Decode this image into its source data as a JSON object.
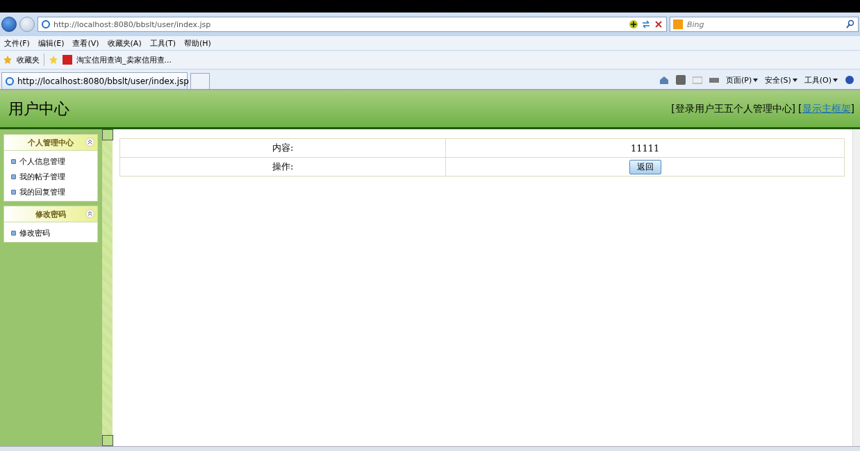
{
  "browser": {
    "address": "http://localhost:8080/bbslt/user/index.jsp",
    "search_placeholder": "Bing",
    "menu": [
      "文件(F)",
      "编辑(E)",
      "查看(V)",
      "收藏夹(A)",
      "工具(T)",
      "帮助(H)"
    ],
    "favorites": {
      "label": "收藏夹",
      "links": [
        "淘宝信用查询_卖家信用查..."
      ]
    },
    "tab": {
      "title": "http://localhost:8080/bbslt/user/index.jsp"
    },
    "command_bar": [
      "页面(P)",
      "安全(S)",
      "工具(O)"
    ]
  },
  "header": {
    "title": "用户中心",
    "login_info": "[登录用户王五个人管理中心]",
    "link_open": "[",
    "link": "显示主框架",
    "link_close": "]"
  },
  "sidebar": [
    {
      "title": "个人管理中心",
      "expanded": true,
      "items": [
        "个人信息管理",
        "我的帖子管理",
        "我的回复管理"
      ]
    },
    {
      "title": "修改密码",
      "expanded": true,
      "items": [
        "修改密码"
      ]
    }
  ],
  "detail": {
    "rows": [
      {
        "label": "内容:",
        "kind": "text",
        "value": "11111"
      },
      {
        "label": "操作:",
        "kind": "button",
        "value": "返回"
      }
    ]
  }
}
